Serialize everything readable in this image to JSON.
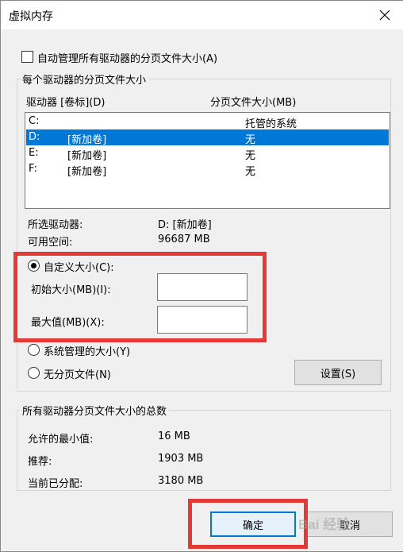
{
  "window": {
    "title": "虚拟内存"
  },
  "auto_manage": {
    "label": "自动管理所有驱动器的分页文件大小(A)",
    "checked": false
  },
  "per_drive_group": {
    "title": "每个驱动器的分页文件大小",
    "col_drive": "驱动器 [卷标](D)",
    "col_size": "分页文件大小(MB)",
    "drives": [
      {
        "letter": "C:",
        "label": "",
        "size": "托管的系统",
        "selected": false
      },
      {
        "letter": "D:",
        "label": "[新加卷]",
        "size": "无",
        "selected": true
      },
      {
        "letter": "E:",
        "label": "[新加卷]",
        "size": "无",
        "selected": false
      },
      {
        "letter": "F:",
        "label": "[新加卷]",
        "size": "无",
        "selected": false
      }
    ],
    "selected_drive_label": "所选驱动器:",
    "selected_drive_value": "D:  [新加卷]",
    "free_space_label": "可用空间:",
    "free_space_value": "96687 MB",
    "custom_size_label": "自定义大小(C):",
    "custom_size_selected": true,
    "initial_size_label": "初始大小(MB)(I):",
    "initial_size_value": "",
    "max_size_label": "最大值(MB)(X):",
    "max_size_value": "",
    "system_managed_label": "系统管理的大小(Y)",
    "no_paging_label": "无分页文件(N)",
    "set_button": "设置(S)"
  },
  "totals_group": {
    "title": "所有驱动器分页文件大小的总数",
    "min_label": "允许的最小值:",
    "min_value": "16 MB",
    "recommended_label": "推荐:",
    "recommended_value": "1903 MB",
    "current_label": "当前已分配:",
    "current_value": "3180 MB"
  },
  "footer": {
    "ok_button": "确定",
    "cancel_button": "取消"
  },
  "annotations": {
    "highlight_color": "#e53935",
    "watermark_text": "Bai 经验"
  }
}
